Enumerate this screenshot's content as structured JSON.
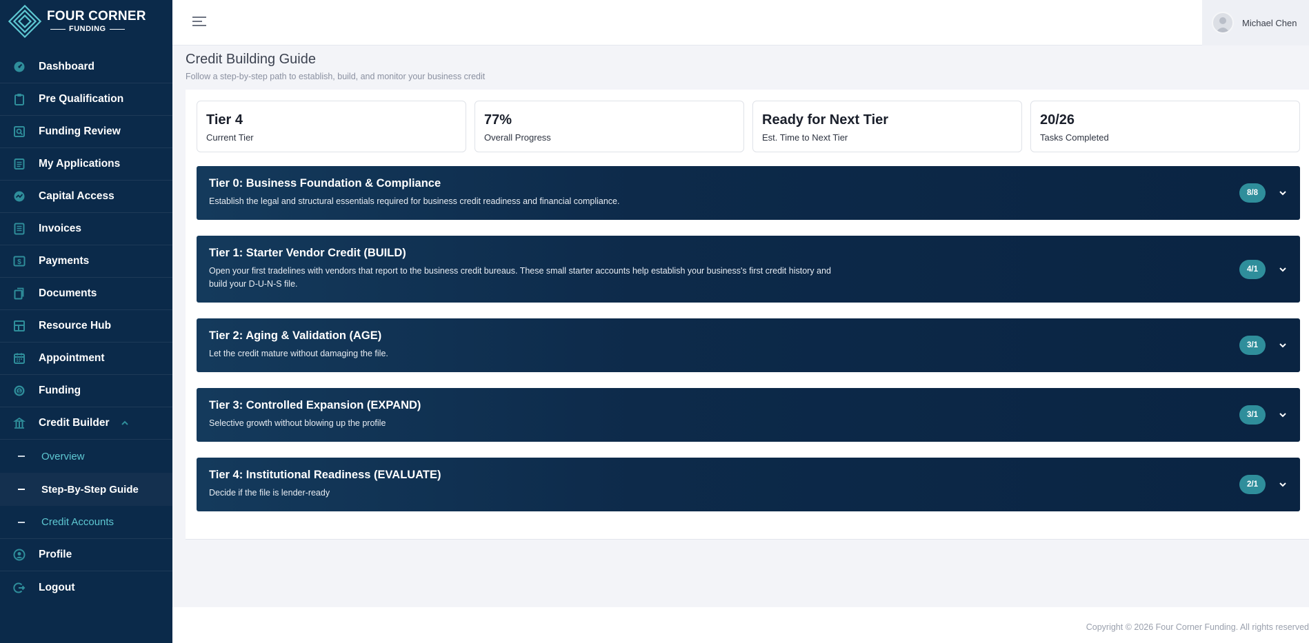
{
  "brand": {
    "line1": "FOUR CORNER",
    "line2": "FUNDING"
  },
  "sidebar": {
    "items": [
      {
        "label": "Dashboard",
        "icon": "gauge-icon"
      },
      {
        "label": "Pre Qualification",
        "icon": "clipboard-icon"
      },
      {
        "label": "Funding Review",
        "icon": "search-document-icon"
      },
      {
        "label": "My Applications",
        "icon": "list-document-icon"
      },
      {
        "label": "Capital Access",
        "icon": "chart-circle-icon"
      },
      {
        "label": "Invoices",
        "icon": "invoice-icon"
      },
      {
        "label": "Payments",
        "icon": "dollar-icon"
      },
      {
        "label": "Documents",
        "icon": "documents-icon"
      },
      {
        "label": "Resource Hub",
        "icon": "grid-icon"
      },
      {
        "label": "Appointment",
        "icon": "calendar-icon"
      },
      {
        "label": "Funding",
        "icon": "coin-icon"
      },
      {
        "label": "Credit Builder",
        "icon": "bank-icon"
      }
    ],
    "sub_items": [
      {
        "label": "Overview"
      },
      {
        "label": "Step-By-Step Guide",
        "active": true
      },
      {
        "label": "Credit Accounts"
      }
    ],
    "bottom_items": [
      {
        "label": "Profile",
        "icon": "user-circle-icon"
      },
      {
        "label": "Logout",
        "icon": "logout-icon"
      }
    ]
  },
  "topbar": {
    "user_name": "Michael Chen"
  },
  "header": {
    "title": "Credit Building Guide",
    "subtitle": "Follow a step-by-step path to establish, build, and monitor your business credit"
  },
  "stats": [
    {
      "value": "Tier 4",
      "label": "Current Tier"
    },
    {
      "value": "77%",
      "label": "Overall Progress"
    },
    {
      "value": "Ready for Next Tier",
      "label": "Est. Time to Next Tier"
    },
    {
      "value": "20/26",
      "label": "Tasks Completed"
    }
  ],
  "tiers": [
    {
      "title": "Tier 0: Business Foundation & Compliance",
      "desc": "Establish the legal and structural essentials required for business credit readiness and financial compliance.",
      "badge": "8/8"
    },
    {
      "title": "Tier 1: Starter Vendor Credit (BUILD)",
      "desc": "Open your first tradelines with vendors that report to the business credit bureaus. These small starter accounts help establish your business's first credit history and build your D-U-N-S file.",
      "badge": "4/1"
    },
    {
      "title": "Tier 2: Aging & Validation (AGE)",
      "desc": "Let the credit mature without damaging the file.",
      "badge": "3/1"
    },
    {
      "title": "Tier 3: Controlled Expansion (EXPAND)",
      "desc": "Selective growth without blowing up the profile",
      "badge": "3/1"
    },
    {
      "title": "Tier 4: Institutional Readiness (EVALUATE)",
      "desc": "Decide if the file is lender-ready",
      "badge": "2/1"
    }
  ],
  "footer": {
    "text": "Copyright © 2026 Four Corner Funding. All rights reserved"
  },
  "colors": {
    "sidebar_bg": "#0b2a4a",
    "accent": "#5ec8d2",
    "badge": "#2f8e9b",
    "tier_bg": "#0d2a4a"
  }
}
